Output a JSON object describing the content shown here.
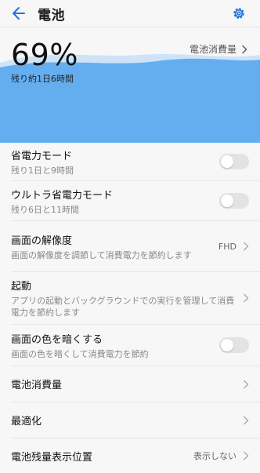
{
  "header": {
    "title": "電池",
    "back_icon": "arrow-back-icon",
    "settings_icon": "gear-icon",
    "accent_color": "#1a73e8"
  },
  "battery": {
    "usage_link": "電池消費量",
    "percent": "69%",
    "level": 0.69,
    "remaining": "残り約1日6時間",
    "wave_color": "#64aef0"
  },
  "rows": {
    "power_saving": {
      "label": "省電力モード",
      "sub": "残り1日と9時間",
      "enabled": false
    },
    "ultra_power_saving": {
      "label": "ウルトラ省電力モード",
      "sub": "残り6日と11時間",
      "enabled": false
    },
    "resolution": {
      "label": "画面の解像度",
      "sub": "画面の解像度を調節して消費電力を節約します",
      "value": "FHD"
    },
    "launch": {
      "label": "起動",
      "sub": "アプリの起動とバックグラウンドでの実行を管理して消費電力を節約します"
    },
    "dim_colors": {
      "label": "画面の色を暗くする",
      "sub": "画面の色を暗くして消費電力を節約",
      "enabled": false
    },
    "battery_usage": {
      "label": "電池消費量"
    },
    "optimize": {
      "label": "最適化"
    },
    "battery_display": {
      "label": "電池残量表示位置",
      "value": "表示しない"
    }
  }
}
